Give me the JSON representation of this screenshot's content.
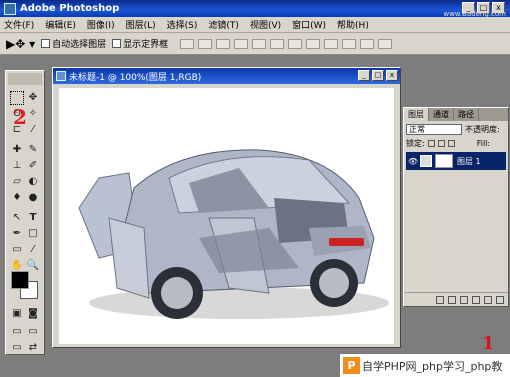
{
  "app": {
    "title": "Adobe Photoshop",
    "watermark_top": "www.Badong.com"
  },
  "menu": [
    "文件(F)",
    "编辑(E)",
    "图像(I)",
    "图层(L)",
    "选择(S)",
    "滤镜(T)",
    "视图(V)",
    "窗口(W)",
    "帮助(H)"
  ],
  "options": {
    "auto_select": "自动选择图层",
    "show_bounds": "显示定界框"
  },
  "document": {
    "title": "未标题-1 @ 100%(图层 1,RGB)"
  },
  "layers_panel": {
    "tabs": [
      "图层",
      "通道",
      "路径"
    ],
    "blend_mode": "正常",
    "opacity_label": "不透明度:",
    "lock_label": "锁定:",
    "fill_label": "Fill:",
    "layer_name": "图层 1"
  },
  "annotations": {
    "marker_1": "1",
    "marker_2": "2"
  },
  "footer_watermark": "自学PHP网_php学习_php教",
  "footer_logo": "P"
}
